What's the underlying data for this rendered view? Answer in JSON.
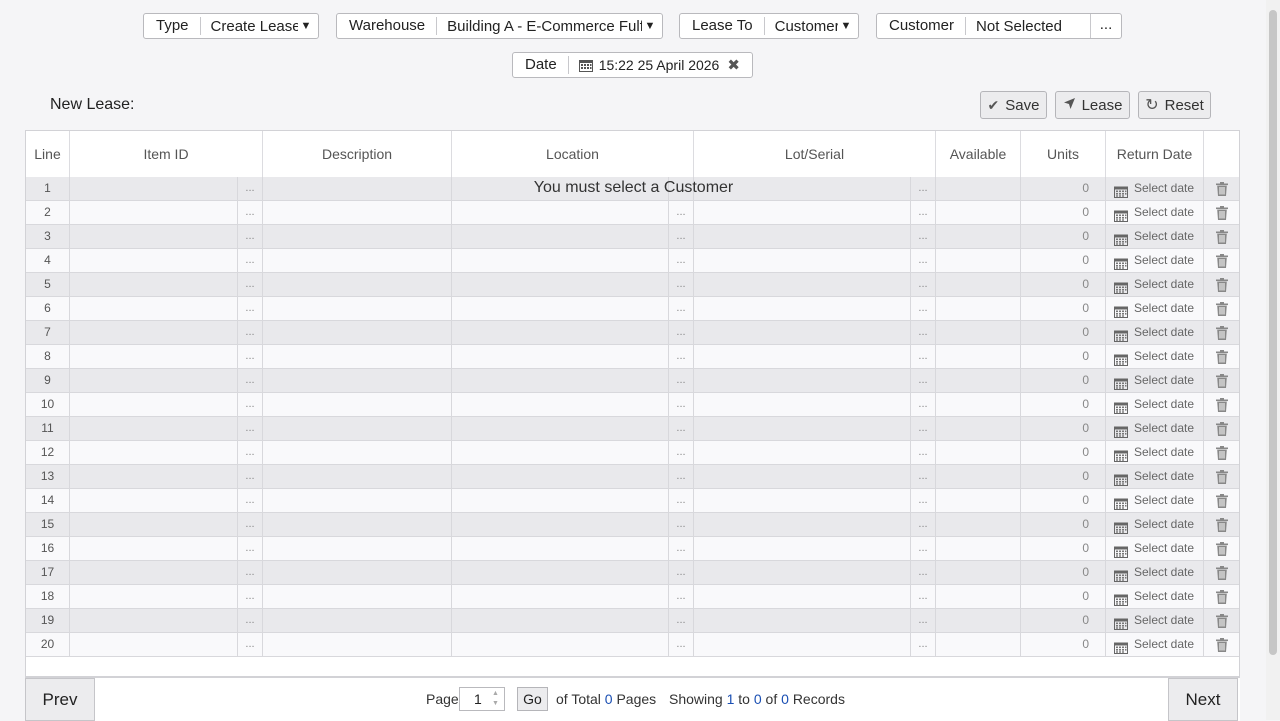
{
  "filters": {
    "type": {
      "label": "Type",
      "value": "Create Lease"
    },
    "warehouse": {
      "label": "Warehouse",
      "value": "Building A - E-Commerce Fulfillment"
    },
    "lease_to": {
      "label": "Lease To",
      "value": "Customer"
    },
    "customer": {
      "label": "Customer",
      "value": "Not Selected",
      "button": "..."
    },
    "date": {
      "label": "Date",
      "value": "15:22 25 April 2026"
    }
  },
  "toolbar": {
    "title": "New Lease:",
    "save": "Save",
    "lease": "Lease",
    "reset": "Reset"
  },
  "grid": {
    "columns": [
      "Line",
      "Item ID",
      "Description",
      "Location",
      "Lot/Serial",
      "Available",
      "Units",
      "Return Date"
    ],
    "message": "You must select a Customer",
    "rows": [
      {
        "line": "1",
        "units": "0",
        "return_date": "Select date"
      },
      {
        "line": "2",
        "units": "0",
        "return_date": "Select date"
      },
      {
        "line": "3",
        "units": "0",
        "return_date": "Select date"
      },
      {
        "line": "4",
        "units": "0",
        "return_date": "Select date"
      },
      {
        "line": "5",
        "units": "0",
        "return_date": "Select date"
      },
      {
        "line": "6",
        "units": "0",
        "return_date": "Select date"
      },
      {
        "line": "7",
        "units": "0",
        "return_date": "Select date"
      },
      {
        "line": "8",
        "units": "0",
        "return_date": "Select date"
      },
      {
        "line": "9",
        "units": "0",
        "return_date": "Select date"
      },
      {
        "line": "10",
        "units": "0",
        "return_date": "Select date"
      },
      {
        "line": "11",
        "units": "0",
        "return_date": "Select date"
      },
      {
        "line": "12",
        "units": "0",
        "return_date": "Select date"
      },
      {
        "line": "13",
        "units": "0",
        "return_date": "Select date"
      },
      {
        "line": "14",
        "units": "0",
        "return_date": "Select date"
      },
      {
        "line": "15",
        "units": "0",
        "return_date": "Select date"
      },
      {
        "line": "16",
        "units": "0",
        "return_date": "Select date"
      },
      {
        "line": "17",
        "units": "0",
        "return_date": "Select date"
      },
      {
        "line": "18",
        "units": "0",
        "return_date": "Select date"
      },
      {
        "line": "19",
        "units": "0",
        "return_date": "Select date"
      },
      {
        "line": "20",
        "units": "0",
        "return_date": "Select date"
      }
    ],
    "ellipsis": "..."
  },
  "pagination": {
    "prev": "Prev",
    "next": "Next",
    "page_label": "Page",
    "page_value": "1",
    "go": "Go",
    "of_total": "of Total",
    "total_pages": "0",
    "pages": "Pages",
    "showing": "Showing",
    "from": "1",
    "to_label": "to",
    "to": "0",
    "of_label": "of",
    "records_total": "0",
    "records": "Records"
  }
}
